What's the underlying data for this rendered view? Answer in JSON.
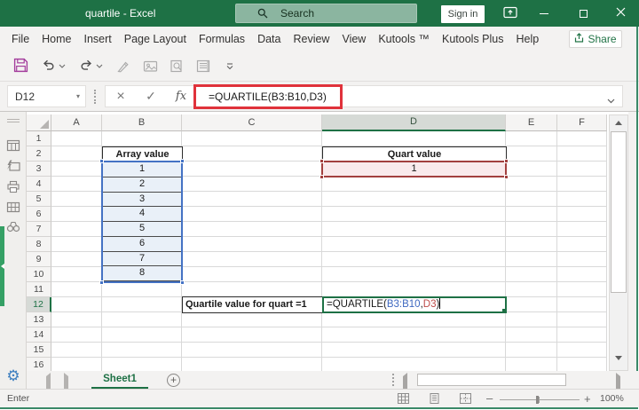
{
  "window": {
    "title": "quartile - Excel",
    "search_placeholder": "Search",
    "sign_in_label": "Sign in"
  },
  "menu": {
    "tabs": [
      "File",
      "Home",
      "Insert",
      "Page Layout",
      "Formulas",
      "Data",
      "Review",
      "View",
      "Kutools ™",
      "Kutools Plus",
      "Help"
    ],
    "share_label": "Share"
  },
  "quick_access": {
    "icons": [
      "save",
      "undo",
      "undo-dropdown",
      "redo",
      "redo-dropdown",
      "pen-sketch",
      "screenshot",
      "print-preview",
      "form",
      "toolbar-overflow"
    ]
  },
  "formula_bar": {
    "name_box": "D12",
    "cancel_glyph": "×",
    "enter_glyph": "✓",
    "fx_label": "fx",
    "formula": "=QUARTILE(B3:B10,D3)"
  },
  "grid": {
    "columns": [
      "A",
      "B",
      "C",
      "D",
      "E",
      "F"
    ],
    "selected_column": "D",
    "row_labels": [
      "1",
      "2",
      "3",
      "4",
      "5",
      "6",
      "7",
      "8",
      "9",
      "10",
      "11",
      "12",
      "13",
      "14",
      "15",
      "16"
    ],
    "selected_row": "12",
    "array_table": {
      "header": "Array value",
      "values": [
        "1",
        "2",
        "3",
        "4",
        "5",
        "6",
        "7",
        "8"
      ]
    },
    "quart_table": {
      "header": "Quart value",
      "value": "1"
    },
    "label_cell": "Quartile value for quart =1",
    "edit_cell": {
      "parts": [
        {
          "text": "=QUARTILE(",
          "color": "#1A1A1A"
        },
        {
          "text": "B3:B10",
          "color": "#3E68C0"
        },
        {
          "text": ",",
          "color": "#1A1A1A"
        },
        {
          "text": "D3",
          "color": "#BE4B48"
        },
        {
          "text": ")",
          "color": "#1A1A1A"
        }
      ]
    }
  },
  "sheet_bar": {
    "sheet_name": "Sheet1",
    "add_label": "+"
  },
  "status_bar": {
    "mode": "Enter",
    "zoom_out": "–",
    "zoom_in": "+",
    "zoom_level": "100%"
  },
  "icons": {
    "search-icon": "magnifier",
    "ribbon-display-options-icon": "window with up arrow",
    "minimize-icon": "–",
    "maximize-icon": "▢",
    "close-icon": "✕",
    "share-icon": "box with up arrow",
    "save-icon": "floppy disk",
    "undo-icon": "curved arrow left",
    "redo-icon": "curved arrow right",
    "select-all-icon": "corner triangle",
    "gear-icon": "⚙",
    "sidebar-icons": [
      "workbook-grid",
      "lightning-pane",
      "printer",
      "table-columns",
      "binoculars"
    ]
  },
  "colors": {
    "titlebar_green": "#1E7145",
    "accent_green": "#217346",
    "selection_blue": "#4472C4",
    "range_fill_blue": "#E9F0F8",
    "ref_red_border": "#A2403F",
    "cell_fill_pink": "#F9EAEC",
    "annotation_red_box": "#E0323B"
  }
}
